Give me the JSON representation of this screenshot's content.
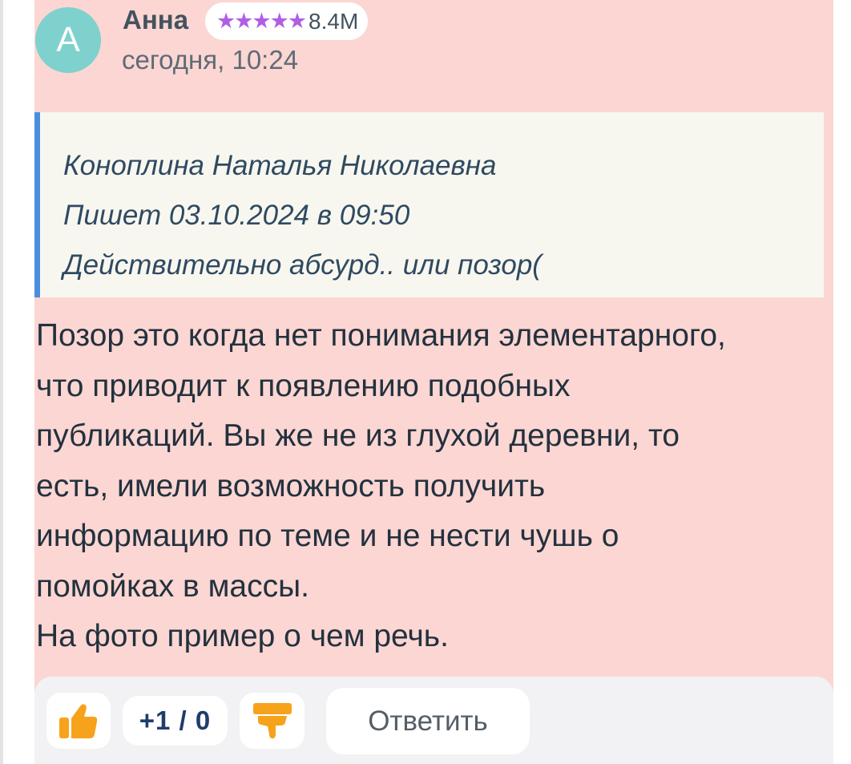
{
  "comment": {
    "avatar_letter": "A",
    "author": "Анна",
    "rating": {
      "stars": "★★★★★",
      "value": "8.4M"
    },
    "time": "сегодня, 10:24",
    "quote": {
      "author": "Коноплина Наталья Николаевна",
      "written": "Пишет 03.10.2024 в 09:50",
      "text": "Действительно абсурд.. или позор("
    },
    "lines": [
      "Позор это когда нет понимания элементарного,",
      "что приводит к появлению подобных",
      "публикаций. Вы же не из глухой деревни, то",
      "есть, имели возможность получить",
      "информацию по теме и не нести чушь о",
      "помойках в массы.",
      "На фото пример о чем речь."
    ]
  },
  "actions": {
    "score": "+1 / 0",
    "reply_label": "Ответить",
    "like_icon": "thumbs-up-icon",
    "dislike_icon": "thumbs-down-icon"
  },
  "colors": {
    "card_background": "#fbd6d2",
    "avatar": "#7fd1cd",
    "stars": "#b15ee6",
    "quote_accent": "#4b8ee0",
    "thumb": "#f7a21b"
  }
}
